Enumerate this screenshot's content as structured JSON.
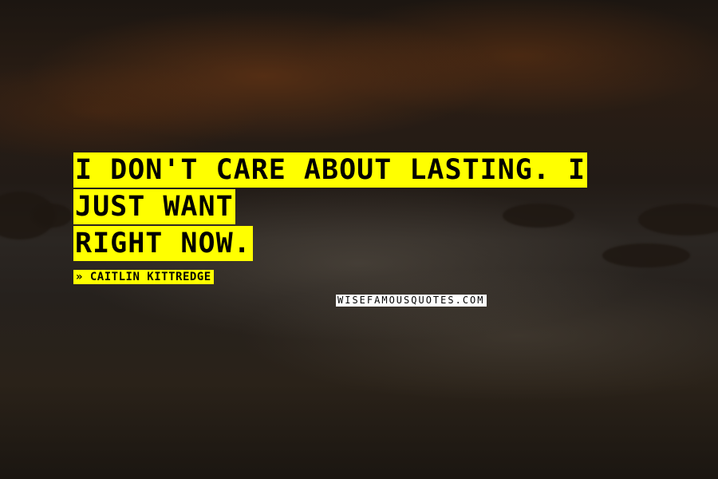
{
  "quote": {
    "line1": "I don't care about lasting. I just want",
    "line2": "right now."
  },
  "author": {
    "prefix": "»",
    "name": "Caitlin Kittredge"
  },
  "watermark": "WISEFAMOUSQUOTES.COM",
  "colors": {
    "highlight": "#ffff00",
    "text": "#000000",
    "watermark_bg": "#ffffff"
  }
}
